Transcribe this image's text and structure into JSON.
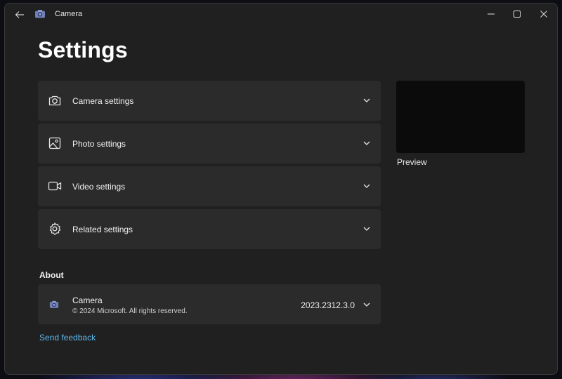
{
  "window": {
    "title": "Camera",
    "back_icon": "back-arrow-icon",
    "controls": [
      "minimize-icon",
      "maximize-icon",
      "close-icon"
    ]
  },
  "page": {
    "title": "Settings"
  },
  "sections": [
    {
      "label": "Camera settings",
      "icon": "camera-icon"
    },
    {
      "label": "Photo settings",
      "icon": "photo-icon"
    },
    {
      "label": "Video settings",
      "icon": "video-icon"
    },
    {
      "label": "Related settings",
      "icon": "gear-icon"
    }
  ],
  "about": {
    "heading": "About",
    "app_name": "Camera",
    "copyright": "© 2024 Microsoft. All rights reserved.",
    "version": "2023.2312.3.0"
  },
  "feedback": {
    "label": "Send feedback"
  },
  "preview": {
    "label": "Preview"
  },
  "colors": {
    "accent_link": "#60b8ec",
    "card_bg": "#2b2b2b",
    "window_bg": "#202020"
  }
}
